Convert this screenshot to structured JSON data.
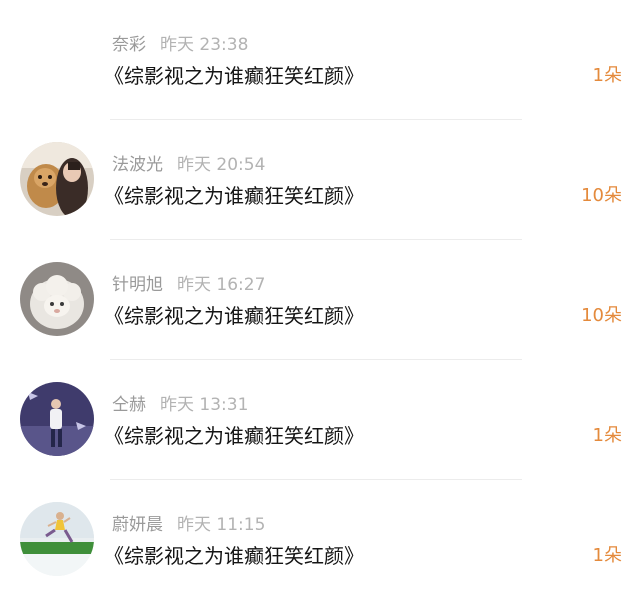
{
  "accent_color": "#e48a3c",
  "comments": [
    {
      "user": "奈彩",
      "time": "昨天 23:38",
      "text": "《综影视之为谁癫狂笑红颜》",
      "count": "1朵",
      "avatar": "none"
    },
    {
      "user": "法波光",
      "time": "昨天 20:54",
      "text": "《综影视之为谁癫狂笑红颜》",
      "count": "10朵",
      "avatar": "dog-and-person-photo"
    },
    {
      "user": "针明旭",
      "time": "昨天 16:27",
      "text": "《综影视之为谁癫狂笑红颜》",
      "count": "10朵",
      "avatar": "sheep-plush-photo"
    },
    {
      "user": "仝赫",
      "time": "昨天 13:31",
      "text": "《综影视之为谁癫狂笑红颜》",
      "count": "1朵",
      "avatar": "person-standing-photo"
    },
    {
      "user": "蔚妍晨",
      "time": "昨天 11:15",
      "text": "《综影视之为谁癫狂笑红颜》",
      "count": "1朵",
      "avatar": "runner-on-grass-photo"
    }
  ]
}
